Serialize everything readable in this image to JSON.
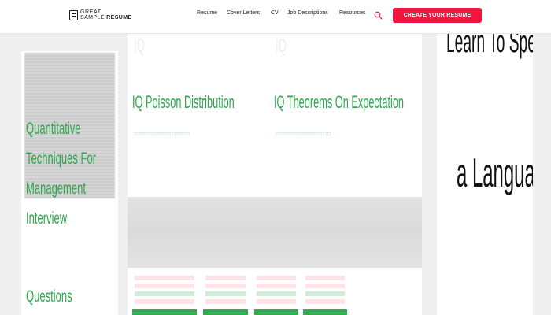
{
  "header": {
    "logo": {
      "line1": "GREAT",
      "line2a": "SAMPLE",
      "line2b": "RESUME"
    },
    "nav": [
      "Resume",
      "Cover Letters",
      "CV",
      "Job Descriptions",
      "Resources"
    ],
    "search_icon": "search-icon",
    "cta_label": "CREATE YOUR RESUME",
    "accent": "#f0163e"
  },
  "cards": {
    "left_title": "Quantitative Techniques For Management Interview",
    "left_title_tail": "Questions",
    "mid": [
      {
        "title": "IQ Poisson Distribution"
      },
      {
        "title": "IQ Theorems On Expectation"
      }
    ],
    "right_title_line1": "Learn To Speak",
    "right_title_line2": "a Language"
  },
  "colors": {
    "green": "#2ea84e",
    "bar_green": "#34a853"
  }
}
